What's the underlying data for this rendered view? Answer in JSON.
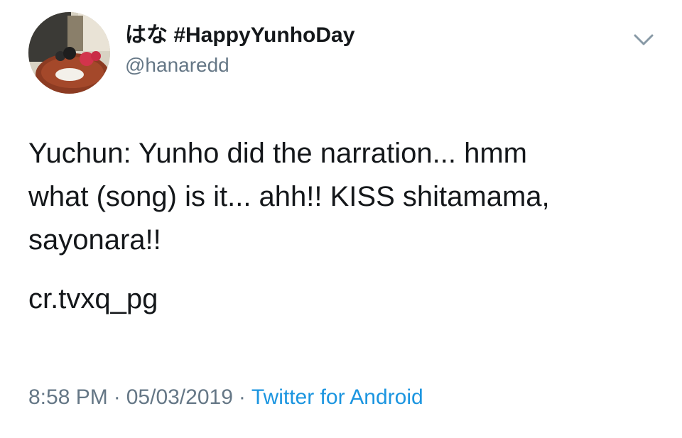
{
  "author": {
    "display_name": "はな #HappyYunhoDay",
    "handle": "@hanaredd",
    "avatar_icon": "profile-photo"
  },
  "header": {
    "menu_icon": "chevron-down-icon"
  },
  "tweet": {
    "text_line1": "Yuchun: Yunho did the narration... hmm",
    "text_line2": "what (song) is it... ahh!! KISS shitamama,",
    "text_line3": "sayonara!!",
    "credit": "cr.tvxq_pg"
  },
  "meta": {
    "time": "8:58 PM",
    "separator": "·",
    "date": "05/03/2019",
    "source": "Twitter for Android"
  },
  "colors": {
    "text": "#14171a",
    "secondary": "#657786",
    "link": "#1b95e0"
  }
}
